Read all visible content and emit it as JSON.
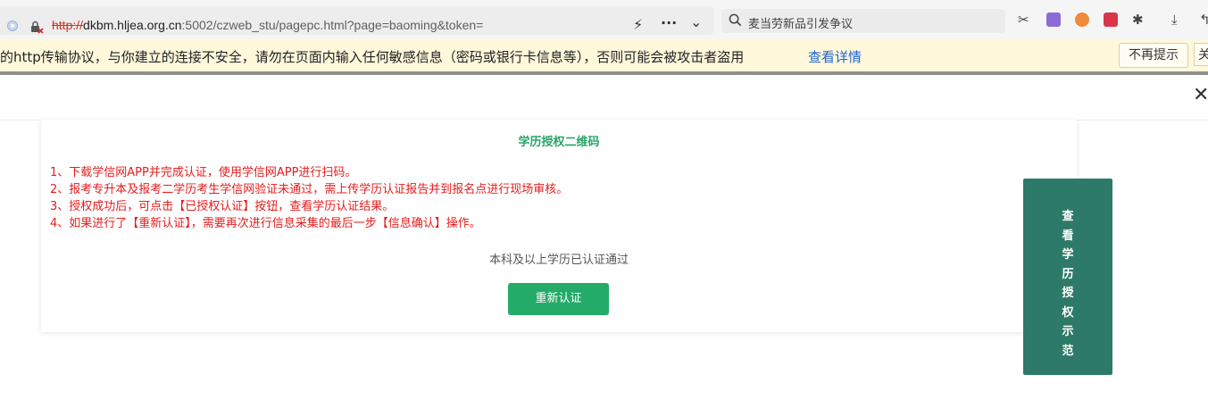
{
  "browser": {
    "url": {
      "scheme": "http://",
      "host": "dkbm.hljea.org.cn",
      "rest": ":5002/czweb_stu/pagepc.html?page=baoming&token="
    },
    "search_text": "麦当劳新品引发争议",
    "accent_colors": {
      "warning_bg": "#fff8db",
      "link": "#1d63d8"
    }
  },
  "warning_bar": {
    "message": "的http传输协议，与你建立的连接不安全，请勿在页面内输入任何敏感信息（密码或银行卡信息等），否则可能会被攻击者盗用",
    "details_link": "查看详情",
    "dismiss_button": "不再提示",
    "partial_button": "关"
  },
  "page": {
    "close_glyph": "✕",
    "title": "学历授权二维码",
    "notes": [
      "1、下载学信网APP并完成认证，使用学信网APP进行扫码。",
      "2、报考专升本及报考二学历考生学信网验证未通过，需上传学历认证报告并到报名点进行现场审核。",
      "3、授权成功后，可点击【已授权认证】按钮，查看学历认证结果。",
      "4、如果进行了【重新认证】，需要再次进行信息采集的最后一步【信息确认】操作。"
    ],
    "status_text": "本科及以上学历已认证通过",
    "reauth_button": "重新认证",
    "side_button": "查看学历授权示范",
    "colors": {
      "title": "#27a568",
      "notes": "#e51c1c",
      "button": "#23ab69",
      "side_button": "#2e7a68"
    }
  }
}
